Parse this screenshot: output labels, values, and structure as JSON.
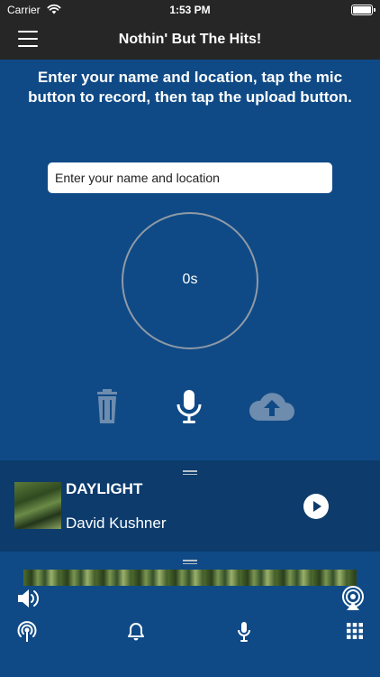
{
  "status_bar": {
    "carrier": "Carrier",
    "time": "1:53 PM"
  },
  "nav": {
    "title": "Nothin' But The Hits!"
  },
  "recorder": {
    "instructions": "Enter your name and location, tap the mic button to record, then tap the upload button.",
    "name_placeholder": "Enter your name and location",
    "timer": "0s"
  },
  "now_playing": {
    "title": "DAYLIGHT",
    "artist": "David Kushner"
  },
  "icons": {
    "menu": "hamburger-menu-icon",
    "trash": "trash-icon",
    "mic": "microphone-icon",
    "upload": "cloud-upload-icon",
    "play": "play-icon",
    "volume": "speaker-icon",
    "airplay": "airplay-icon",
    "broadcast": "broadcast-icon",
    "bell": "bell-icon",
    "grid": "grid-icon"
  },
  "colors": {
    "background": "#0f4a86",
    "now_playing_bg": "#0c3b6c",
    "header_bg": "#262626",
    "muted_icon": "#6e8cae"
  }
}
